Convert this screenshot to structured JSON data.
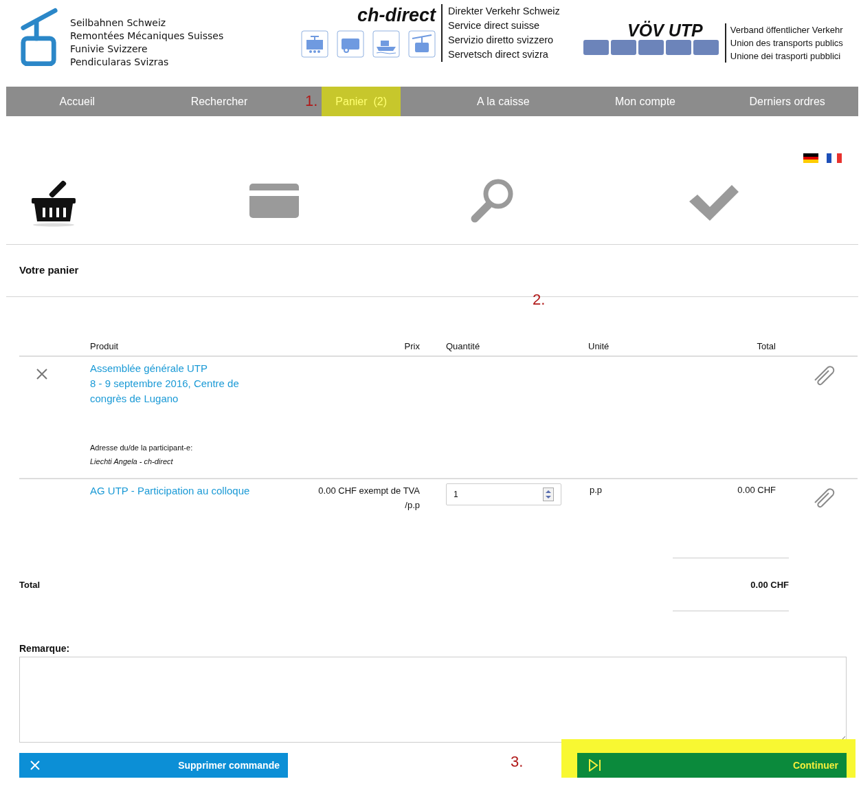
{
  "header": {
    "org_lines": [
      "Seilbahnen Schweiz",
      "Remontées Mécaniques Suisses",
      "Funivie Svizzere",
      "Pendicularas Svizras"
    ],
    "ch_direct": {
      "title": "ch-direct",
      "lines": [
        "Direkter Verkehr Schweiz",
        "Service direct suisse",
        "Servizio diretto svizzero",
        "Servetsch direct svizra"
      ]
    },
    "voev": {
      "title": "VÖV UTP",
      "lines": [
        "Verband öffentlicher Verkehr",
        "Union des transports publics",
        "Unione dei trasporti pubblici"
      ]
    }
  },
  "nav": {
    "items": [
      {
        "label": "Accueil",
        "selected": false,
        "highlighted": false
      },
      {
        "label": "Rechercher",
        "selected": false,
        "highlighted": false
      },
      {
        "label": "Panier  (2)",
        "selected": true,
        "highlighted": true,
        "annotation": "1."
      },
      {
        "label": "A la caisse",
        "selected": false,
        "highlighted": false
      },
      {
        "label": "Mon compte",
        "selected": false,
        "highlighted": false
      },
      {
        "label": "Derniers ordres",
        "selected": false,
        "highlighted": false
      }
    ]
  },
  "steps": [
    {
      "kind": "cart",
      "active": true
    },
    {
      "kind": "card",
      "active": false
    },
    {
      "kind": "search",
      "active": false
    },
    {
      "kind": "check",
      "active": false
    }
  ],
  "cart": {
    "title": "Votre panier",
    "annotation": "2.",
    "columns": [
      "Produit",
      "Prix",
      "Quantité",
      "Unité",
      "Total"
    ],
    "rows": [
      {
        "removable": true,
        "product": "Assemblée générale UTP",
        "product_detail": "8 - 9 septembre 2016, Centre de congrès de Lugano",
        "address_label": "Adresse du/de la participant-e:",
        "address_value": "Liechti Angela - ch-direct"
      },
      {
        "removable": false,
        "product": "AG UTP - Participation au colloque",
        "price": "0.00 CHF exempt de TVA",
        "price_unit": "/p.p",
        "quantity": "1",
        "unit": "p.p",
        "total": "0.00 CHF"
      }
    ],
    "total_label": "Total",
    "total_value": "0.00 CHF"
  },
  "remark": {
    "label": "Remarque:"
  },
  "buttons": {
    "delete": {
      "label": "Supprimer commande"
    },
    "continue": {
      "label": "Continuer",
      "highlighted": true,
      "annotation": "3."
    }
  }
}
